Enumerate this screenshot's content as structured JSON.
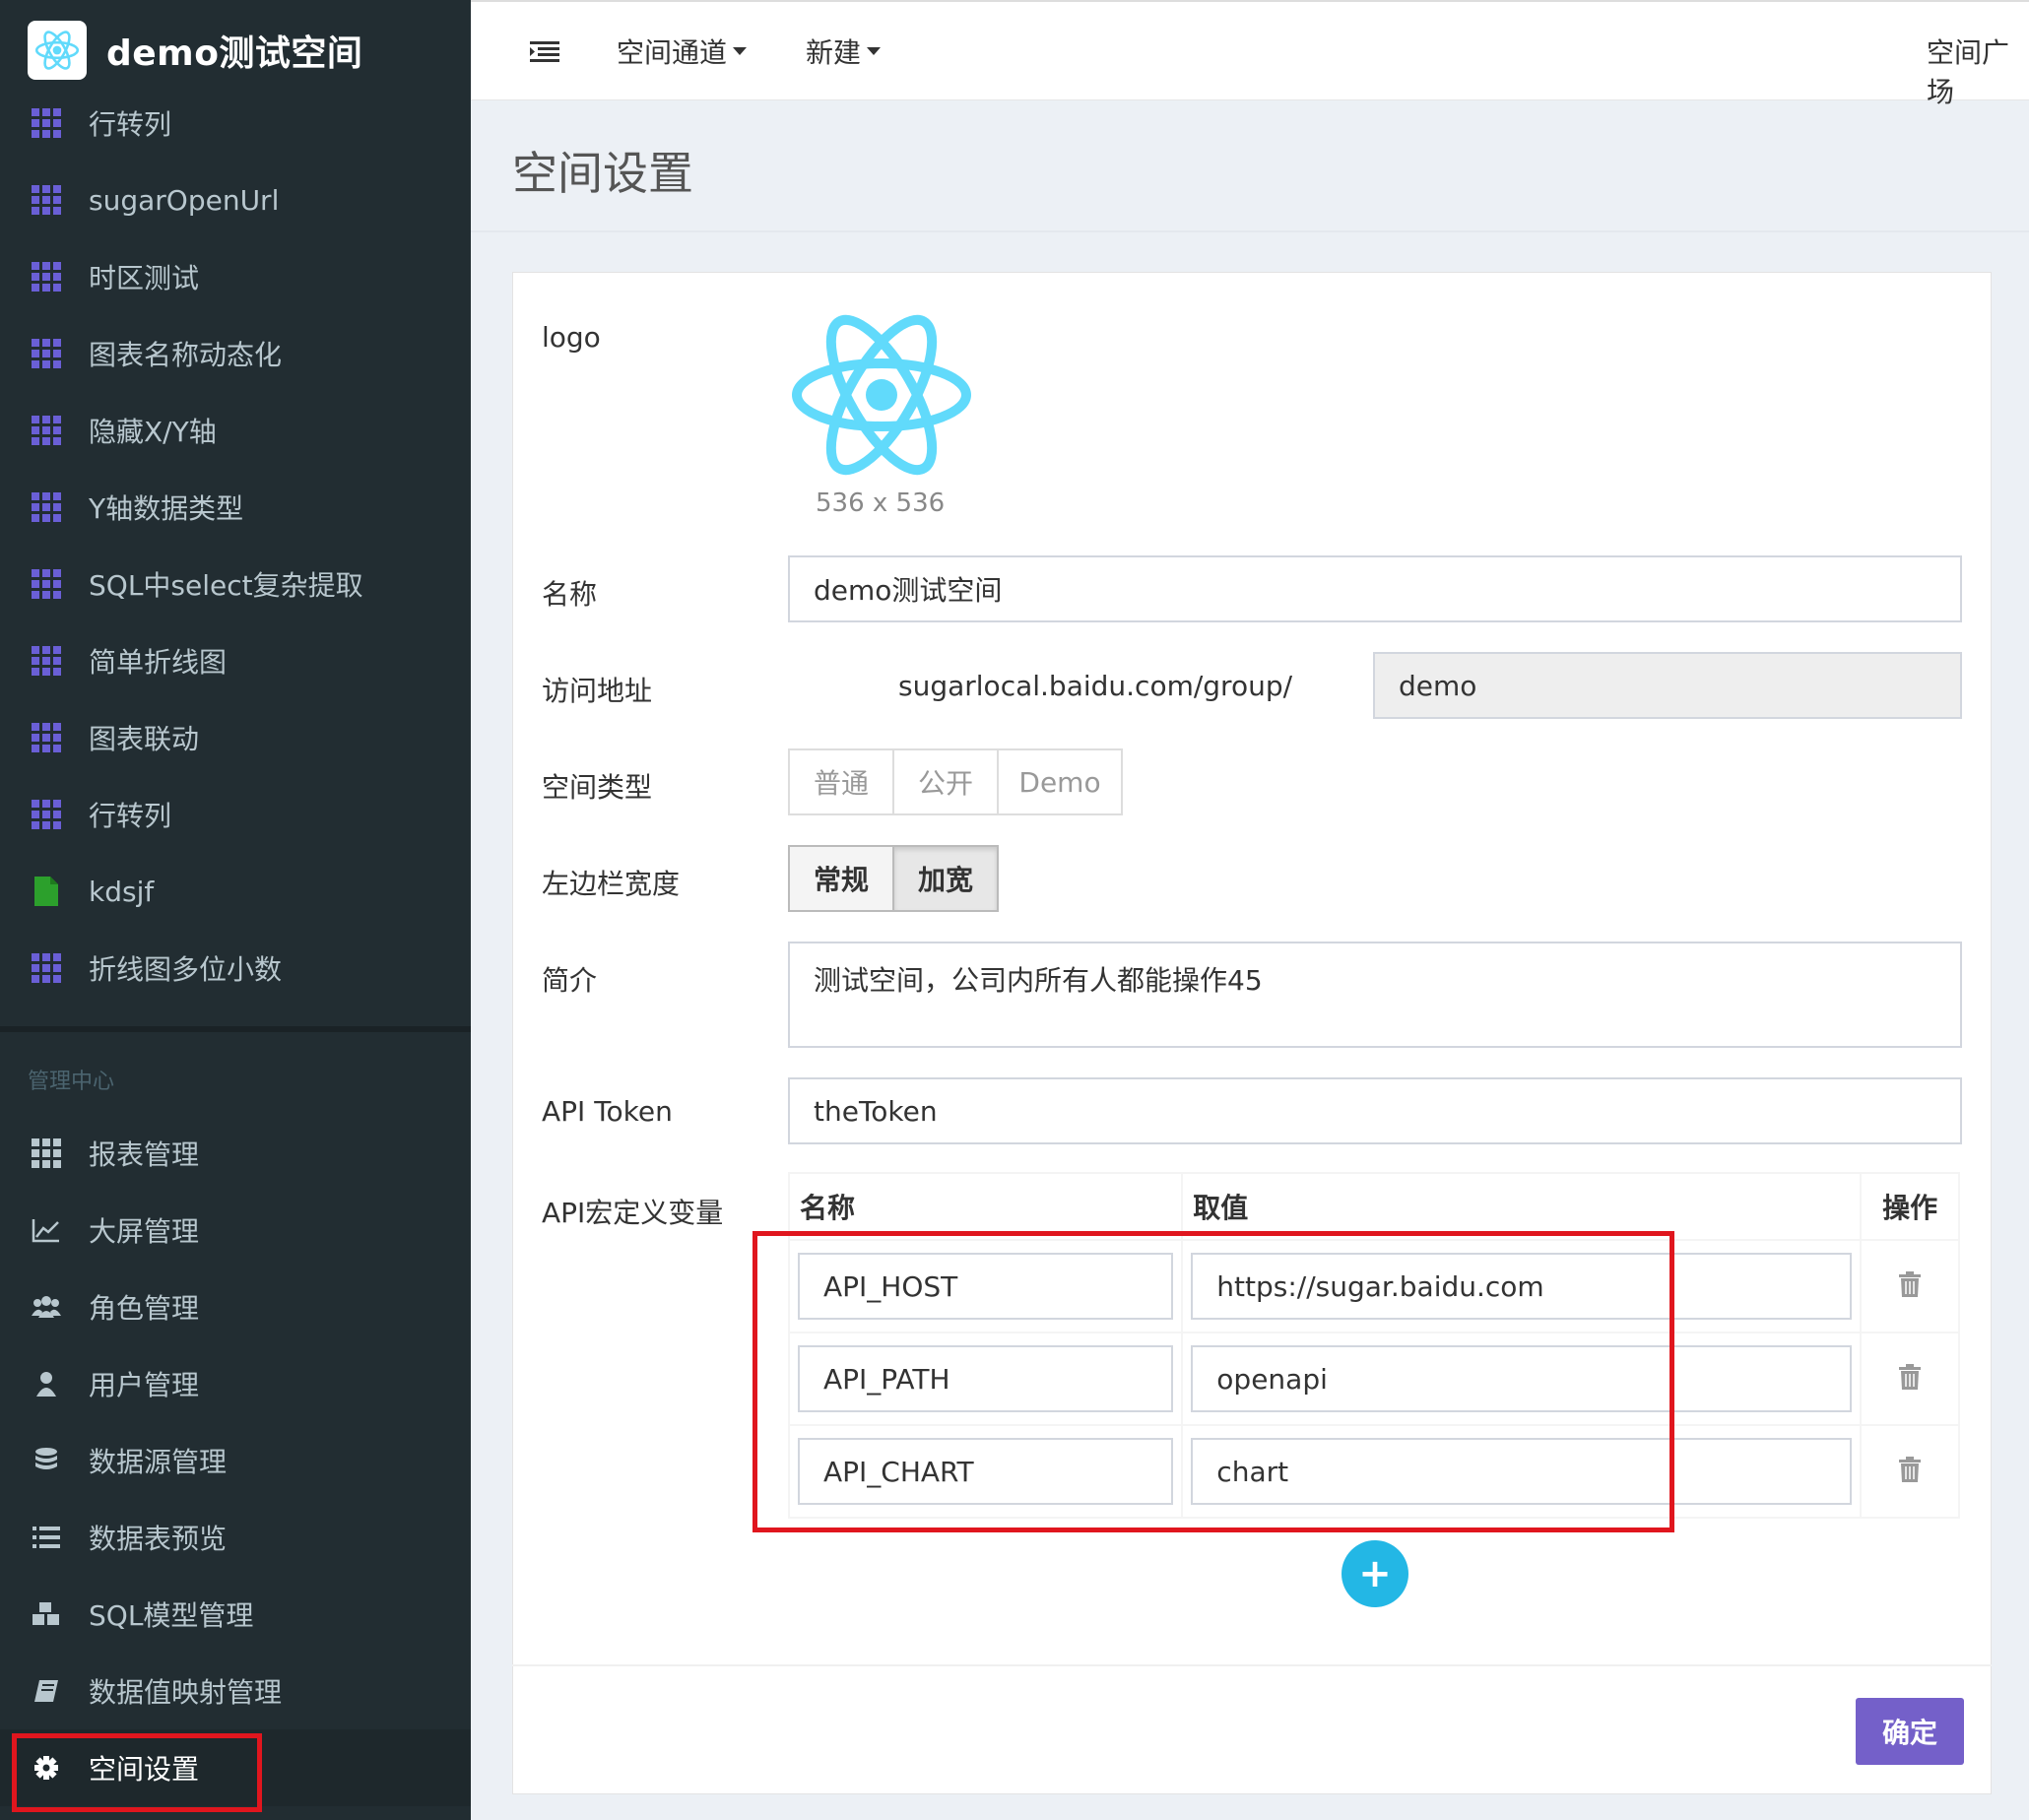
{
  "brand": {
    "title": "demo测试空间",
    "logo_icon": "react-atom-icon"
  },
  "sidebar": {
    "items": [
      {
        "label": "行转列",
        "icon": "grid-icon"
      },
      {
        "label": "sugarOpenUrl",
        "icon": "grid-icon"
      },
      {
        "label": "时区测试",
        "icon": "grid-icon"
      },
      {
        "label": "图表名称动态化",
        "icon": "grid-icon"
      },
      {
        "label": "隐藏X/Y轴",
        "icon": "grid-icon"
      },
      {
        "label": "Y轴数据类型",
        "icon": "grid-icon"
      },
      {
        "label": "SQL中select复杂提取",
        "icon": "grid-icon"
      },
      {
        "label": "简单折线图",
        "icon": "grid-icon"
      },
      {
        "label": "图表联动",
        "icon": "grid-icon"
      },
      {
        "label": "行转列",
        "icon": "grid-icon"
      },
      {
        "label": "kdsjf",
        "icon": "file-icon"
      },
      {
        "label": "折线图多位小数",
        "icon": "grid-icon"
      }
    ],
    "manage_header": "管理中心",
    "manage_items": [
      {
        "label": "报表管理",
        "icon": "grid-icon"
      },
      {
        "label": "大屏管理",
        "icon": "line-chart-icon"
      },
      {
        "label": "角色管理",
        "icon": "users-icon"
      },
      {
        "label": "用户管理",
        "icon": "user-icon"
      },
      {
        "label": "数据源管理",
        "icon": "database-icon"
      },
      {
        "label": "数据表预览",
        "icon": "list-icon"
      },
      {
        "label": "SQL模型管理",
        "icon": "cubes-icon"
      },
      {
        "label": "数据值映射管理",
        "icon": "book-icon"
      },
      {
        "label": "空间设置",
        "icon": "gear-icon"
      }
    ]
  },
  "topbar": {
    "space_channel": "空间通道",
    "new": "新建",
    "square": "空间广场"
  },
  "page": {
    "title": "空间设置"
  },
  "form": {
    "logo_label": "logo",
    "logo_size": "536 x 536",
    "name_label": "名称",
    "name_value": "demo测试空间",
    "url_label": "访问地址",
    "url_prefix": "sugarlocal.baidu.com/group/",
    "url_value": "demo",
    "type_label": "空间类型",
    "type_options": [
      "普通",
      "公开",
      "Demo"
    ],
    "sidebar_width_label": "左边栏宽度",
    "sidebar_width_options": [
      "常规",
      "加宽"
    ],
    "sidebar_width_selected": "加宽",
    "intro_label": "简介",
    "intro_value": "测试空间，公司内所有人都能操作45",
    "token_label": "API Token",
    "token_value": "theToken",
    "macro_label": "API宏定义变量",
    "macro_headers": {
      "name": "名称",
      "value": "取值",
      "op": "操作"
    },
    "macros": [
      {
        "name": "API_HOST",
        "value": "https://sugar.baidu.com"
      },
      {
        "name": "API_PATH",
        "value": "openapi"
      },
      {
        "name": "API_CHART",
        "value": "chart"
      }
    ],
    "add_label": "+",
    "submit_label": "确定"
  },
  "colors": {
    "sidebar_bg": "#222d32",
    "accent": "#23b7e5",
    "submit": "#7460c9",
    "highlight": "#e0161e"
  }
}
